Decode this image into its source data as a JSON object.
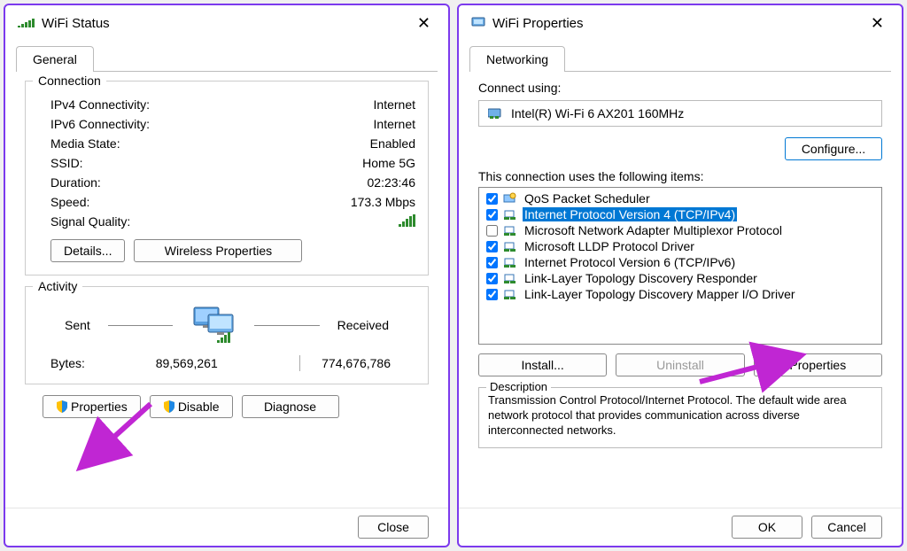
{
  "left": {
    "title": "WiFi Status",
    "tab": "General",
    "connection": {
      "legend": "Connection",
      "rows": [
        {
          "label": "IPv4 Connectivity:",
          "value": "Internet"
        },
        {
          "label": "IPv6 Connectivity:",
          "value": "Internet"
        },
        {
          "label": "Media State:",
          "value": "Enabled"
        },
        {
          "label": "SSID:",
          "value": "Home 5G"
        },
        {
          "label": "Duration:",
          "value": "02:23:46"
        },
        {
          "label": "Speed:",
          "value": "173.3 Mbps"
        }
      ],
      "signal_quality_label": "Signal Quality:",
      "details_btn": "Details...",
      "wireless_props_btn": "Wireless Properties"
    },
    "activity": {
      "legend": "Activity",
      "sent_label": "Sent",
      "received_label": "Received",
      "bytes_label": "Bytes:",
      "bytes_sent": "89,569,261",
      "bytes_received": "774,676,786",
      "properties_btn": "Properties",
      "disable_btn": "Disable",
      "diagnose_btn": "Diagnose"
    },
    "close_btn": "Close"
  },
  "right": {
    "title": "WiFi Properties",
    "tab": "Networking",
    "connect_using_label": "Connect using:",
    "adapter": "Intel(R) Wi-Fi 6 AX201 160MHz",
    "configure_btn": "Configure...",
    "items_label": "This connection uses the following items:",
    "items": [
      {
        "checked": true,
        "selected": false,
        "icon": "svc",
        "label": "QoS Packet Scheduler"
      },
      {
        "checked": true,
        "selected": true,
        "icon": "proto",
        "label": "Internet Protocol Version 4 (TCP/IPv4)"
      },
      {
        "checked": false,
        "selected": false,
        "icon": "proto",
        "label": "Microsoft Network Adapter Multiplexor Protocol"
      },
      {
        "checked": true,
        "selected": false,
        "icon": "proto",
        "label": "Microsoft LLDP Protocol Driver"
      },
      {
        "checked": true,
        "selected": false,
        "icon": "proto",
        "label": "Internet Protocol Version 6 (TCP/IPv6)"
      },
      {
        "checked": true,
        "selected": false,
        "icon": "proto",
        "label": "Link-Layer Topology Discovery Responder"
      },
      {
        "checked": true,
        "selected": false,
        "icon": "proto",
        "label": "Link-Layer Topology Discovery Mapper I/O Driver"
      }
    ],
    "install_btn": "Install...",
    "uninstall_btn": "Uninstall",
    "properties_btn": "Properties",
    "description_legend": "Description",
    "description_text": "Transmission Control Protocol/Internet Protocol. The default wide area network protocol that provides communication across diverse interconnected networks.",
    "ok_btn": "OK",
    "cancel_btn": "Cancel"
  }
}
